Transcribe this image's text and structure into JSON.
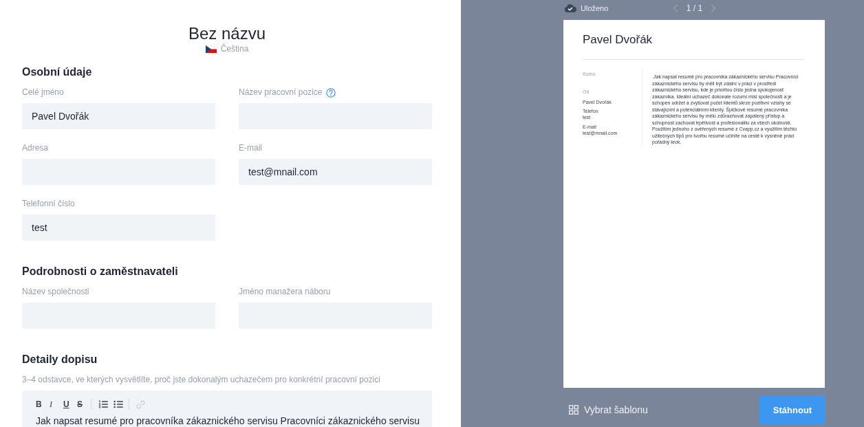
{
  "header": {
    "title": "Bez názvu",
    "language": "Čeština"
  },
  "sections": [
    {
      "title": "Osobní údaje",
      "fields": [
        {
          "label": "Celé jméno",
          "value": "Pavel Dvořák",
          "help": false
        },
        {
          "label": "Název pracovní pozice",
          "help": true
        },
        {
          "label": "Adresa",
          "help": false
        },
        {
          "label": "E-mail",
          "value": "test@mnail.com",
          "help": false
        },
        {
          "label": "Telefonní číslo",
          "value": "test",
          "help": false
        }
      ]
    },
    {
      "title": "Podrobnosti o zaměstnavateli",
      "fields": [
        {
          "label": "Název společnosti",
          "help": false
        },
        {
          "label": "Jméno manažera náboru",
          "help": false
        }
      ]
    },
    {
      "title": "Detaily dopisu",
      "hint": "3–4 odstavce, ve kterých vysvětlíte, proč jste dokonalým uchazečem pro konkrétní pracovní pozici",
      "editor": {
        "format_buttons": [
          {
            "kind": "bold",
            "label": "B"
          },
          {
            "kind": "italic",
            "label": "I"
          },
          {
            "kind": "underline",
            "label": "U"
          },
          {
            "kind": "strike",
            "label": "S"
          }
        ],
        "link_disabled": true,
        "text": "Jak napsat resumé pro pracovníka zákaznického servisu Pracovníci zákaznického servisu"
      }
    }
  ],
  "preview": {
    "save_status": "Uloženo",
    "pager": {
      "label": "1 / 1",
      "prev_disabled": true,
      "next_disabled": true
    },
    "document": {
      "name": "Pavel Dvořák",
      "recipient": {
        "heading": "Komu"
      },
      "sender": {
        "heading": "Od",
        "name": "Pavel Dvořák",
        "contacts": [
          {
            "label": "Telefon",
            "value": "test"
          },
          {
            "label": "E-mail",
            "value": "test@mnail.com"
          }
        ]
      },
      "body": "Jak napsat resumé pro pracovníka zákaznického servisu Pracovníci zákaznického servisu by měli být zdatní v práci v prostředí zákaznického servisu, kde je prioritou číslo jedna spokojenost zákazníka. Ideální uchazeč dokonale rozumí misi společnosti a je schopen udržet a zvyšovat počet klientů skrze pozitivní vztahy se stávajícími a potenciálními klienty. Špičkové resumé pracovníka zákaznického servisu by mělo zdůrazňovat zapálený přístup a schopnost zachovat trpělivost a profesionalitu za všech okolností. Použitím jednoho z ověřených resumé z Cvapp.cz a využitím těchto užitečných tipů pro tvorbu resumé učiníte na cestě k vysněné práci pořádný krok."
    }
  },
  "footer": {
    "template_button": "Vybrat šablonu",
    "download_button": "Stáhnout"
  }
}
